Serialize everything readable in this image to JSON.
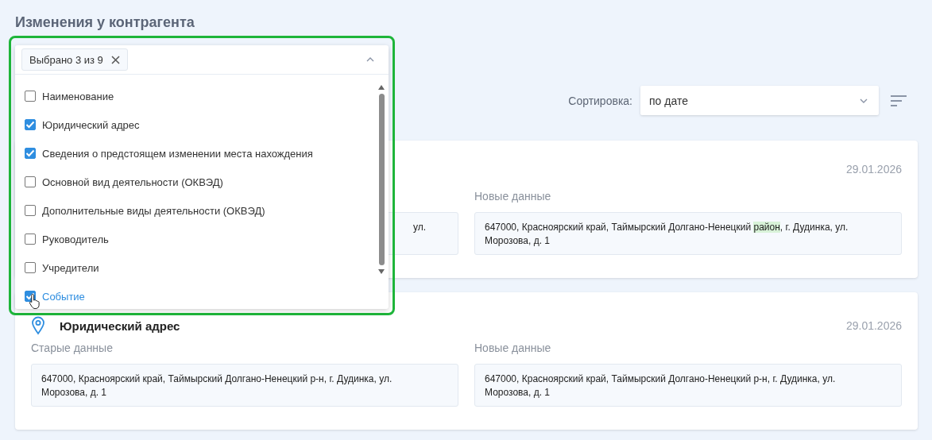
{
  "title": "Изменения у контрагента",
  "filter": {
    "chip": "Выбрано 3 из 9",
    "expanded": true,
    "items": [
      {
        "label": "Наименование",
        "checked": false,
        "hovered": false
      },
      {
        "label": "Юридический адрес",
        "checked": true,
        "hovered": false
      },
      {
        "label": "Сведения о предстоящем изменении места нахождения",
        "checked": true,
        "hovered": false
      },
      {
        "label": "Основной вид деятельности (ОКВЭД)",
        "checked": false,
        "hovered": false
      },
      {
        "label": "Дополнительные виды деятельности (ОКВЭД)",
        "checked": false,
        "hovered": false
      },
      {
        "label": "Руководитель",
        "checked": false,
        "hovered": false
      },
      {
        "label": "Учредители",
        "checked": false,
        "hovered": false
      },
      {
        "label": "Событие",
        "checked": true,
        "hovered": true
      }
    ]
  },
  "sort": {
    "label": "Сортировка:",
    "value": "по дате"
  },
  "cards": [
    {
      "date": "29.01.2026",
      "old_text": "ул.",
      "new_label": "Новые данные",
      "new_parts": [
        {
          "text": "647000, Красноярский край, Таймырский Долгано-Ненецкий ",
          "highlighted": false
        },
        {
          "text": "район",
          "highlighted": true
        },
        {
          "text": ", г. Дудинка, ул. Морозова, д. 1",
          "highlighted": false
        }
      ]
    },
    {
      "title": "Юридический адрес",
      "date": "29.01.2026",
      "old_label": "Старые данные",
      "old_text": "647000, Красноярский край, Таймырский Долгано-Ненецкий р-н, г. Дудинка, ул. Морозова, д. 1",
      "new_label": "Новые данные",
      "new_parts": [
        {
          "text": "647000, Красноярский край, Таймырский Долгано-Ненецкий р-н, г. Дудинка, ул. Морозова, д. 1",
          "highlighted": false
        }
      ]
    }
  ]
}
